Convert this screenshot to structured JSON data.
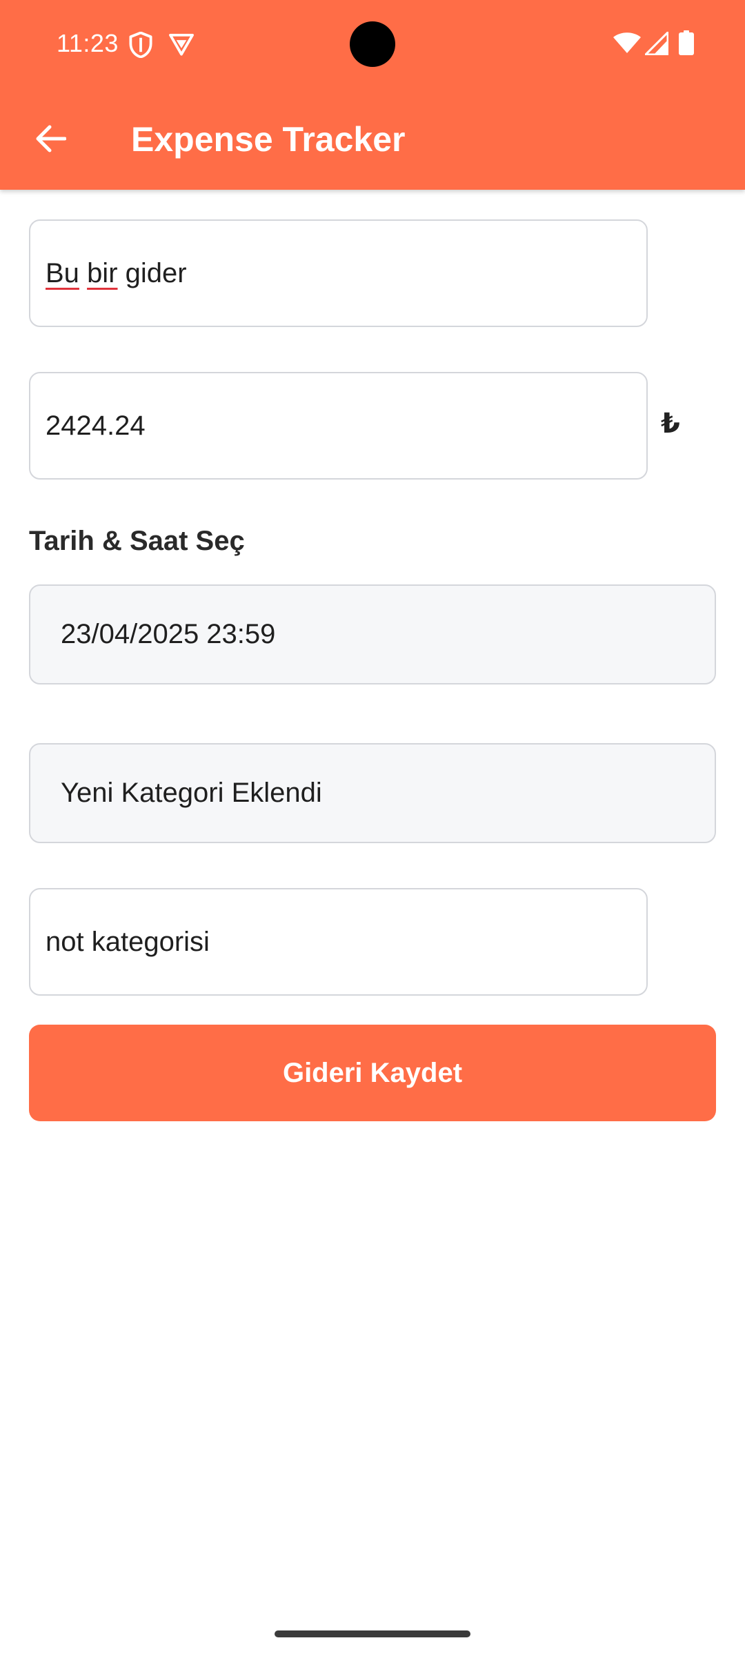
{
  "colors": {
    "accent": "#FF6D47",
    "on_accent": "#FFFFFF",
    "field_border": "#D4D6DB",
    "field_fill": "#F6F7F9",
    "spellcheck_underline": "#E0323B"
  },
  "status_bar": {
    "time": "11:23",
    "icons": [
      "shield-icon",
      "vpn-icon",
      "wifi-icon",
      "cell-signal-icon",
      "battery-icon"
    ]
  },
  "app_bar": {
    "title": "Expense Tracker",
    "back_icon": "arrow-left-icon"
  },
  "form": {
    "description": {
      "value_words_misspelled": [
        "Bu",
        "bir"
      ],
      "value_rest": "gider"
    },
    "amount": {
      "value": "2424.24",
      "currency_symbol": "₺"
    },
    "datetime": {
      "label": "Tarih & Saat Seç",
      "value": "23/04/2025 23:59"
    },
    "category": {
      "value": "Yeni Kategori Eklendi"
    },
    "note": {
      "value": "not kategorisi"
    },
    "submit_label": "Gideri Kaydet"
  }
}
